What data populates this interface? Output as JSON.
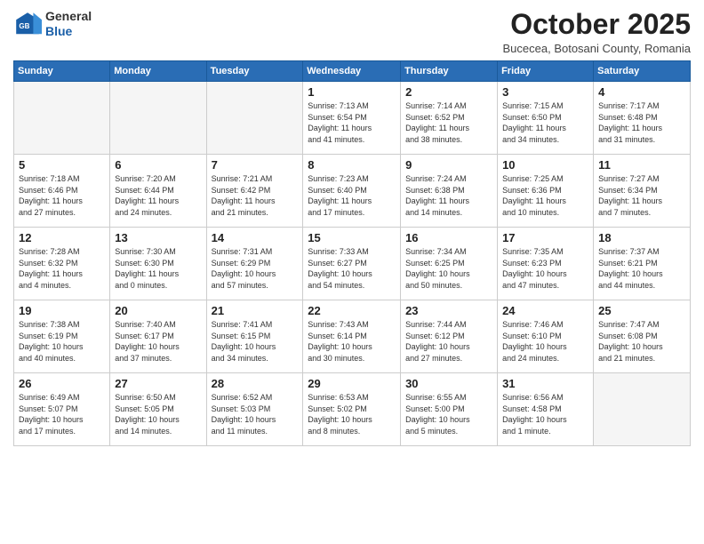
{
  "header": {
    "logo_general": "General",
    "logo_blue": "Blue",
    "month_title": "October 2025",
    "location": "Bucecea, Botosani County, Romania"
  },
  "weekdays": [
    "Sunday",
    "Monday",
    "Tuesday",
    "Wednesday",
    "Thursday",
    "Friday",
    "Saturday"
  ],
  "weeks": [
    [
      {
        "day": "",
        "info": ""
      },
      {
        "day": "",
        "info": ""
      },
      {
        "day": "",
        "info": ""
      },
      {
        "day": "1",
        "info": "Sunrise: 7:13 AM\nSunset: 6:54 PM\nDaylight: 11 hours\nand 41 minutes."
      },
      {
        "day": "2",
        "info": "Sunrise: 7:14 AM\nSunset: 6:52 PM\nDaylight: 11 hours\nand 38 minutes."
      },
      {
        "day": "3",
        "info": "Sunrise: 7:15 AM\nSunset: 6:50 PM\nDaylight: 11 hours\nand 34 minutes."
      },
      {
        "day": "4",
        "info": "Sunrise: 7:17 AM\nSunset: 6:48 PM\nDaylight: 11 hours\nand 31 minutes."
      }
    ],
    [
      {
        "day": "5",
        "info": "Sunrise: 7:18 AM\nSunset: 6:46 PM\nDaylight: 11 hours\nand 27 minutes."
      },
      {
        "day": "6",
        "info": "Sunrise: 7:20 AM\nSunset: 6:44 PM\nDaylight: 11 hours\nand 24 minutes."
      },
      {
        "day": "7",
        "info": "Sunrise: 7:21 AM\nSunset: 6:42 PM\nDaylight: 11 hours\nand 21 minutes."
      },
      {
        "day": "8",
        "info": "Sunrise: 7:23 AM\nSunset: 6:40 PM\nDaylight: 11 hours\nand 17 minutes."
      },
      {
        "day": "9",
        "info": "Sunrise: 7:24 AM\nSunset: 6:38 PM\nDaylight: 11 hours\nand 14 minutes."
      },
      {
        "day": "10",
        "info": "Sunrise: 7:25 AM\nSunset: 6:36 PM\nDaylight: 11 hours\nand 10 minutes."
      },
      {
        "day": "11",
        "info": "Sunrise: 7:27 AM\nSunset: 6:34 PM\nDaylight: 11 hours\nand 7 minutes."
      }
    ],
    [
      {
        "day": "12",
        "info": "Sunrise: 7:28 AM\nSunset: 6:32 PM\nDaylight: 11 hours\nand 4 minutes."
      },
      {
        "day": "13",
        "info": "Sunrise: 7:30 AM\nSunset: 6:30 PM\nDaylight: 11 hours\nand 0 minutes."
      },
      {
        "day": "14",
        "info": "Sunrise: 7:31 AM\nSunset: 6:29 PM\nDaylight: 10 hours\nand 57 minutes."
      },
      {
        "day": "15",
        "info": "Sunrise: 7:33 AM\nSunset: 6:27 PM\nDaylight: 10 hours\nand 54 minutes."
      },
      {
        "day": "16",
        "info": "Sunrise: 7:34 AM\nSunset: 6:25 PM\nDaylight: 10 hours\nand 50 minutes."
      },
      {
        "day": "17",
        "info": "Sunrise: 7:35 AM\nSunset: 6:23 PM\nDaylight: 10 hours\nand 47 minutes."
      },
      {
        "day": "18",
        "info": "Sunrise: 7:37 AM\nSunset: 6:21 PM\nDaylight: 10 hours\nand 44 minutes."
      }
    ],
    [
      {
        "day": "19",
        "info": "Sunrise: 7:38 AM\nSunset: 6:19 PM\nDaylight: 10 hours\nand 40 minutes."
      },
      {
        "day": "20",
        "info": "Sunrise: 7:40 AM\nSunset: 6:17 PM\nDaylight: 10 hours\nand 37 minutes."
      },
      {
        "day": "21",
        "info": "Sunrise: 7:41 AM\nSunset: 6:15 PM\nDaylight: 10 hours\nand 34 minutes."
      },
      {
        "day": "22",
        "info": "Sunrise: 7:43 AM\nSunset: 6:14 PM\nDaylight: 10 hours\nand 30 minutes."
      },
      {
        "day": "23",
        "info": "Sunrise: 7:44 AM\nSunset: 6:12 PM\nDaylight: 10 hours\nand 27 minutes."
      },
      {
        "day": "24",
        "info": "Sunrise: 7:46 AM\nSunset: 6:10 PM\nDaylight: 10 hours\nand 24 minutes."
      },
      {
        "day": "25",
        "info": "Sunrise: 7:47 AM\nSunset: 6:08 PM\nDaylight: 10 hours\nand 21 minutes."
      }
    ],
    [
      {
        "day": "26",
        "info": "Sunrise: 6:49 AM\nSunset: 5:07 PM\nDaylight: 10 hours\nand 17 minutes."
      },
      {
        "day": "27",
        "info": "Sunrise: 6:50 AM\nSunset: 5:05 PM\nDaylight: 10 hours\nand 14 minutes."
      },
      {
        "day": "28",
        "info": "Sunrise: 6:52 AM\nSunset: 5:03 PM\nDaylight: 10 hours\nand 11 minutes."
      },
      {
        "day": "29",
        "info": "Sunrise: 6:53 AM\nSunset: 5:02 PM\nDaylight: 10 hours\nand 8 minutes."
      },
      {
        "day": "30",
        "info": "Sunrise: 6:55 AM\nSunset: 5:00 PM\nDaylight: 10 hours\nand 5 minutes."
      },
      {
        "day": "31",
        "info": "Sunrise: 6:56 AM\nSunset: 4:58 PM\nDaylight: 10 hours\nand 1 minute."
      },
      {
        "day": "",
        "info": ""
      }
    ]
  ]
}
